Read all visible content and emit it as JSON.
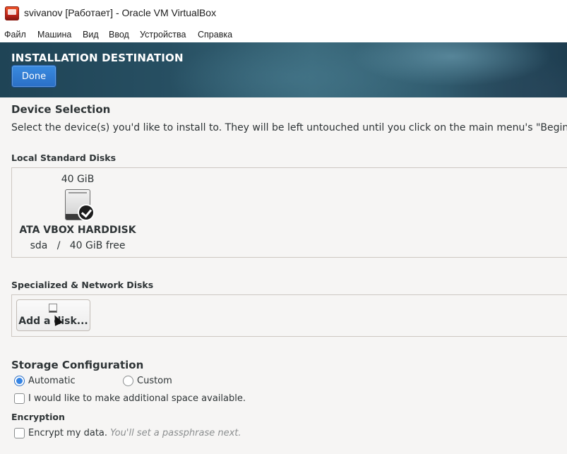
{
  "window": {
    "title": "svivanov [Работает] - Oracle VM VirtualBox"
  },
  "menubar": {
    "items": [
      "Файл",
      "Машина",
      "Вид",
      "Ввод",
      "Устройства",
      "Справка"
    ]
  },
  "header": {
    "title": "INSTALLATION DESTINATION",
    "done_label": "Done"
  },
  "device_selection": {
    "title": "Device Selection",
    "description": "Select the device(s) you'd like to install to.  They will be left untouched until you click on the main menu's \"Begin"
  },
  "local_disks": {
    "title": "Local Standard Disks",
    "disk": {
      "size": "40 GiB",
      "name": "ATA VBOX HARDDISK",
      "device": "sda",
      "separator": "/",
      "free": "40 GiB free",
      "selected": true
    }
  },
  "network_disks": {
    "title": "Specialized & Network Disks",
    "add_label": "Add a disk..."
  },
  "storage": {
    "title": "Storage Configuration",
    "automatic_label": "Automatic",
    "custom_label": "Custom",
    "selected": "Automatic",
    "reclaim_label": "I would like to make additional space available."
  },
  "encryption": {
    "title": "Encryption",
    "encrypt_label": "Encrypt my data.",
    "encrypt_hint": "You'll set a passphrase next."
  },
  "colors": {
    "accent": "#3584e4",
    "done_button": "#2a6fc6"
  }
}
